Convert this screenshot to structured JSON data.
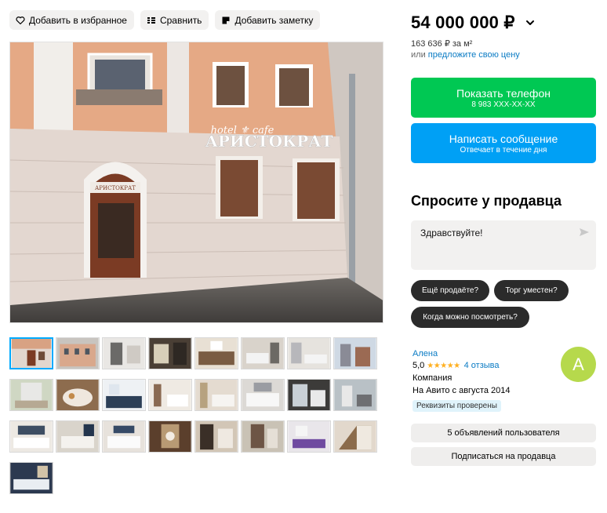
{
  "actions": {
    "favorite": "Добавить в избранное",
    "compare": "Сравнить",
    "note": "Добавить заметку"
  },
  "hero": {
    "sign_top": "hotel ⚜ cafe",
    "sign_main": "АРИСТОКРАТ",
    "door_sign": "АРИСТОКРАТ"
  },
  "thumbnails": [
    "thumb-1",
    "thumb-2",
    "thumb-3",
    "thumb-4",
    "thumb-5",
    "thumb-6",
    "thumb-7",
    "thumb-8",
    "thumb-9",
    "thumb-10",
    "thumb-11",
    "thumb-12",
    "thumb-13",
    "thumb-14",
    "thumb-15",
    "thumb-16",
    "thumb-17",
    "thumb-18",
    "thumb-19",
    "thumb-20",
    "thumb-21",
    "thumb-22",
    "thumb-23",
    "thumb-24",
    "thumb-25"
  ],
  "price": {
    "value": "54 000 000 ₽",
    "per_m2": "163 636 ₽ за м²",
    "offer_prefix": "или",
    "offer_link": "предложите свою цену"
  },
  "buttons": {
    "phone_title": "Показать телефон",
    "phone_sub": "8 983 XXX-XX-XX",
    "message_title": "Написать сообщение",
    "message_sub": "Отвечает в течение дня"
  },
  "ask": {
    "title": "Спросите у продавца",
    "input_value": "Здравствуйте!",
    "chips": [
      "Ещё продаёте?",
      "Торг уместен?",
      "Когда можно посмотреть?"
    ]
  },
  "seller": {
    "name": "Алена",
    "rating": "5,0",
    "stars": "★★★★★",
    "reviews": "4 отзыва",
    "type": "Компания",
    "since": "На Авито с августа 2014",
    "badge": "Реквизиты проверены",
    "avatar_letter": "А",
    "avatar_color": "#b6d94c"
  },
  "seller_actions": {
    "listings": "5 объявлений пользователя",
    "subscribe": "Подписаться на продавца"
  },
  "colors": {
    "phone_button": "#00c853",
    "message_button": "#00a0f5",
    "link": "#0a7bc4",
    "stars": "#ffb021"
  }
}
